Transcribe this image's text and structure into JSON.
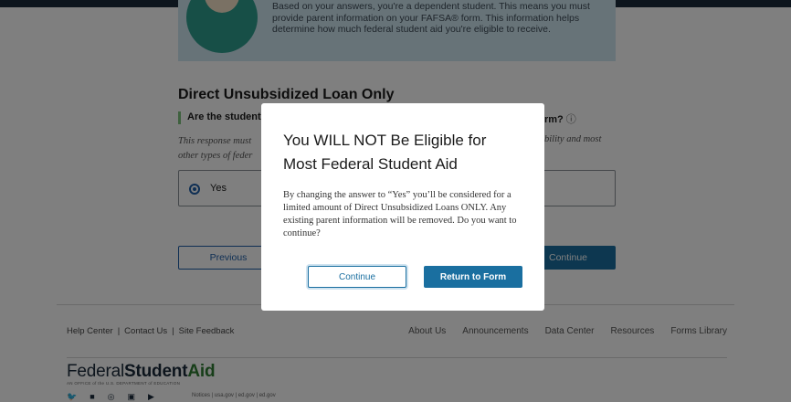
{
  "info_box": {
    "text": "Based on your answers, you're a dependent student. This means you must provide parent information on your FAFSA® form. This information helps determine how much federal student aid you're eligible to receive."
  },
  "section": {
    "title": "Direct Unsubsidized Loan Only",
    "question_left": "Are the student's",
    "question_right": "rm?",
    "info_icon": "ⓘ",
    "hint_left": "This response must other types of feder",
    "hint_right": "bility and most"
  },
  "answer": {
    "yes_label": "Yes"
  },
  "nav": {
    "previous_label": "Previous",
    "continue_label": "Continue"
  },
  "modal": {
    "title": "You WILL NOT Be Eligible for Most Federal Student Aid",
    "body": "By changing the answer to “Yes” you’ll be considered for a limited amount of Direct Unsubsidized Loans ONLY. Any existing parent information will be removed. Do you want to continue?",
    "continue_label": "Continue",
    "return_label": "Return to Form"
  },
  "footer": {
    "help_center": "Help Center",
    "contact_us": "Contact Us",
    "site_feedback": "Site Feedback",
    "separator": "|",
    "right_links": [
      "About Us",
      "Announcements",
      "Data Center",
      "Resources",
      "Forms Library"
    ],
    "logo_federal": "Federal",
    "logo_student": "Student",
    "logo_aid": "Aid",
    "logo_sub": "AN OFFICE of the U.S. DEPARTMENT of EDUCATION",
    "bottom_links": "Notices | usa.gov | ed.gov | ed.gov",
    "socials": [
      "twitter-icon",
      "facebook-icon",
      "instagram-icon",
      "linkedin-icon",
      "youtube-icon"
    ]
  }
}
